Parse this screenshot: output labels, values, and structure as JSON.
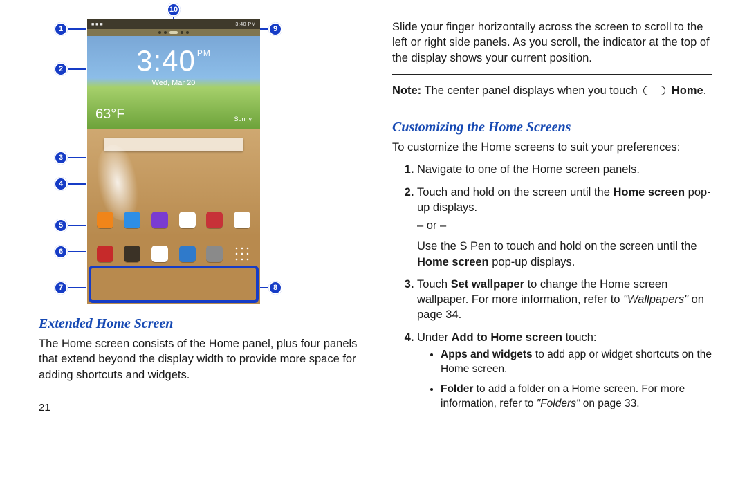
{
  "page_number": "21",
  "diagram": {
    "status_time": "3:40 PM",
    "clock_time": "3:40",
    "clock_ampm": "PM",
    "clock_date": "Wed, Mar 20",
    "temp": "63°F",
    "weather": "Sunny",
    "callouts": [
      "1",
      "2",
      "3",
      "4",
      "5",
      "6",
      "7",
      "8",
      "9",
      "10"
    ]
  },
  "left": {
    "title": "Extended Home Screen",
    "para": "The Home screen consists of the Home panel, plus four panels that extend beyond the display width to provide more space for adding shortcuts and widgets."
  },
  "right": {
    "intro": "Slide your finger horizontally across the screen to scroll to the left or right side panels. As you scroll, the indicator at the top of the display shows your current position.",
    "note_prefix": "Note:",
    "note_text": "The center panel displays when you touch",
    "note_home": "Home",
    "title": "Customizing the Home Screens",
    "lead": "To customize the Home screens to suit your preferences:",
    "steps": {
      "s1": "Navigate to one of the Home screen panels.",
      "s2a": "Touch and hold on the screen until the ",
      "s2b": "Home screen",
      "s2c": " pop-up displays.",
      "or": "– or –",
      "s2d": "Use the S Pen to touch and hold on the screen until the ",
      "s2e": "Home screen",
      "s2f": " pop-up displays.",
      "s3a": "Touch ",
      "s3b": "Set wallpaper",
      "s3c": " to change the Home screen wallpaper. For more information, refer to ",
      "s3ref": "\"Wallpapers\"",
      "s3d": " on page 34.",
      "s4a": "Under ",
      "s4b": "Add to Home screen",
      "s4c": " touch:"
    },
    "bullets": {
      "b1a": "Apps and widgets",
      "b1b": " to add app or widget shortcuts on the Home screen.",
      "b2a": "Folder",
      "b2b": " to add a folder on a Home screen. For more information, refer to ",
      "b2ref": "\"Folders\"",
      "b2c": " on page 33."
    }
  }
}
